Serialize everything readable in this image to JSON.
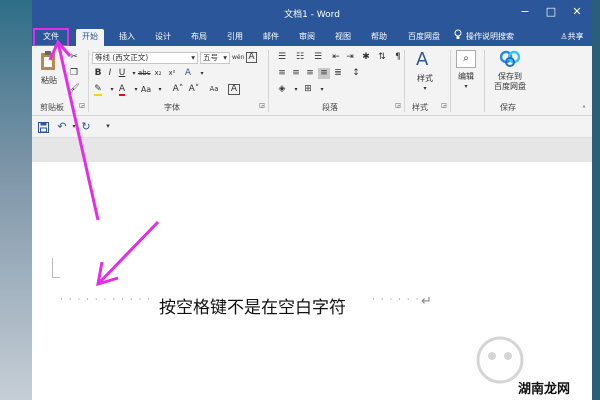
{
  "window": {
    "title": "文档1 - Word",
    "controls": [
      "−",
      "□",
      "✕"
    ]
  },
  "tabs": [
    {
      "label": "文件"
    },
    {
      "label": "开始"
    },
    {
      "label": "插入"
    },
    {
      "label": "设计"
    },
    {
      "label": "布局"
    },
    {
      "label": "引用"
    },
    {
      "label": "邮件"
    },
    {
      "label": "审阅"
    },
    {
      "label": "视图"
    },
    {
      "label": "帮助"
    },
    {
      "label": "百度网盘"
    }
  ],
  "tellme": {
    "label": "操作说明搜索"
  },
  "share": {
    "label": "共享"
  },
  "ribbon": {
    "clipboard": {
      "paste_label": "粘贴",
      "group_label": "剪贴板"
    },
    "font": {
      "font_name": "等线 (西文正文)",
      "font_size": "五号",
      "group_label": "字体",
      "wen_glyph": "wén",
      "a_glyph": "A"
    },
    "paragraph": {
      "group_label": "段落"
    },
    "styles": {
      "label": "样式",
      "group_label": "样式"
    },
    "editing": {
      "label": "编辑"
    },
    "save": {
      "label_line1": "保存到",
      "label_line2": "百度网盘",
      "group_label": "保存"
    }
  },
  "qat": {
    "save_icon": "save-icon",
    "undo_icon": "undo-icon",
    "redo_icon": "redo-icon",
    "customize": "▾"
  },
  "document": {
    "leading_dots": "· · · · · · · · · · ·",
    "text": "按空格键不是在空白字符",
    "trailing_dots": "· · · · · ·",
    "paragraph_mark": "↵"
  },
  "watermark": {
    "text": "湖南龙网"
  },
  "colors": {
    "word_blue": "#2b579a",
    "annotation_magenta": "#e32de8",
    "ribbon_bg": "#f3f3f3"
  }
}
